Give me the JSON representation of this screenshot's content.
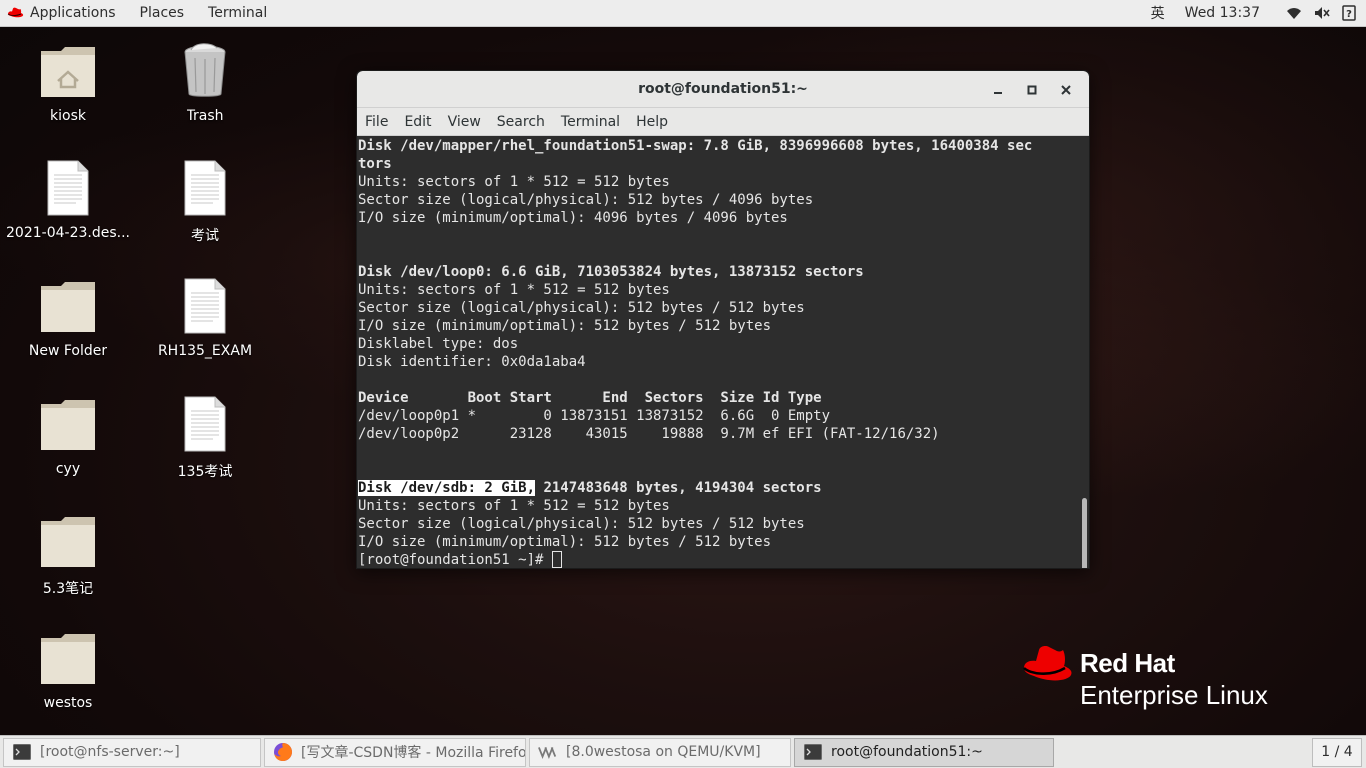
{
  "topbar": {
    "applications": "Applications",
    "places": "Places",
    "terminal": "Terminal",
    "input_method": "英",
    "clock": "Wed 13:37"
  },
  "desktop": {
    "col1": [
      {
        "label": "kiosk",
        "icon": "home-folder-icon"
      },
      {
        "label": "2021-04-23.des...",
        "icon": "document-icon"
      },
      {
        "label": "New Folder",
        "icon": "folder-icon"
      },
      {
        "label": "cyy",
        "icon": "folder-icon"
      },
      {
        "label": "5.3笔记",
        "icon": "folder-icon"
      },
      {
        "label": "westos",
        "icon": "folder-icon"
      }
    ],
    "col2": [
      {
        "label": "Trash",
        "icon": "trash-icon"
      },
      {
        "label": "考试",
        "icon": "document-icon"
      },
      {
        "label": "RH135_EXAM",
        "icon": "document-icon"
      },
      {
        "label": "135考试",
        "icon": "document-icon"
      }
    ]
  },
  "terminal": {
    "title": "root@foundation51:~",
    "menu": [
      "File",
      "Edit",
      "View",
      "Search",
      "Terminal",
      "Help"
    ],
    "lines": {
      "l1": "Disk /dev/mapper/rhel_foundation51-swap: 7.8 GiB, 8396996608 bytes, 16400384 sec",
      "l2": "tors",
      "l3": "Units: sectors of 1 * 512 = 512 bytes",
      "l4": "Sector size (logical/physical): 512 bytes / 4096 bytes",
      "l5": "I/O size (minimum/optimal): 4096 bytes / 4096 bytes",
      "l6": "Disk /dev/loop0: 6.6 GiB, 7103053824 bytes, 13873152 sectors",
      "l7": "Units: sectors of 1 * 512 = 512 bytes",
      "l8": "Sector size (logical/physical): 512 bytes / 512 bytes",
      "l9": "I/O size (minimum/optimal): 512 bytes / 512 bytes",
      "l10": "Disklabel type: dos",
      "l11": "Disk identifier: 0x0da1aba4",
      "l12": "Device       Boot Start      End  Sectors  Size Id Type",
      "l13": "/dev/loop0p1 *        0 13873151 13873152  6.6G  0 Empty",
      "l14": "/dev/loop0p2      23128    43015    19888  9.7M ef EFI (FAT-12/16/32)",
      "l15_sel": "Disk /dev/sdb: 2 GiB,",
      "l15_rest": " 2147483648 bytes, 4194304 sectors",
      "l16": "Units: sectors of 1 * 512 = 512 bytes",
      "l17": "Sector size (logical/physical): 512 bytes / 512 bytes",
      "l18": "I/O size (minimum/optimal): 512 bytes / 512 bytes",
      "prompt": "[root@foundation51 ~]# "
    }
  },
  "logo": {
    "brand": "Red Hat",
    "product": "Enterprise Linux"
  },
  "taskbar": {
    "tasks": [
      {
        "label": "[root@nfs-server:~]",
        "icon": "terminal-icon"
      },
      {
        "label": "[写文章-CSDN博客 - Mozilla Firefox]",
        "icon": "firefox-icon"
      },
      {
        "label": "[8.0westosa on QEMU/KVM]",
        "icon": "virt-manager-icon"
      },
      {
        "label": "root@foundation51:~",
        "icon": "terminal-icon"
      }
    ],
    "workspace": "1 / 4"
  },
  "colors": {
    "redhat_red": "#ee0000",
    "terminal_bg": "#2d2d2d",
    "terminal_fg": "#e5e5e5"
  }
}
